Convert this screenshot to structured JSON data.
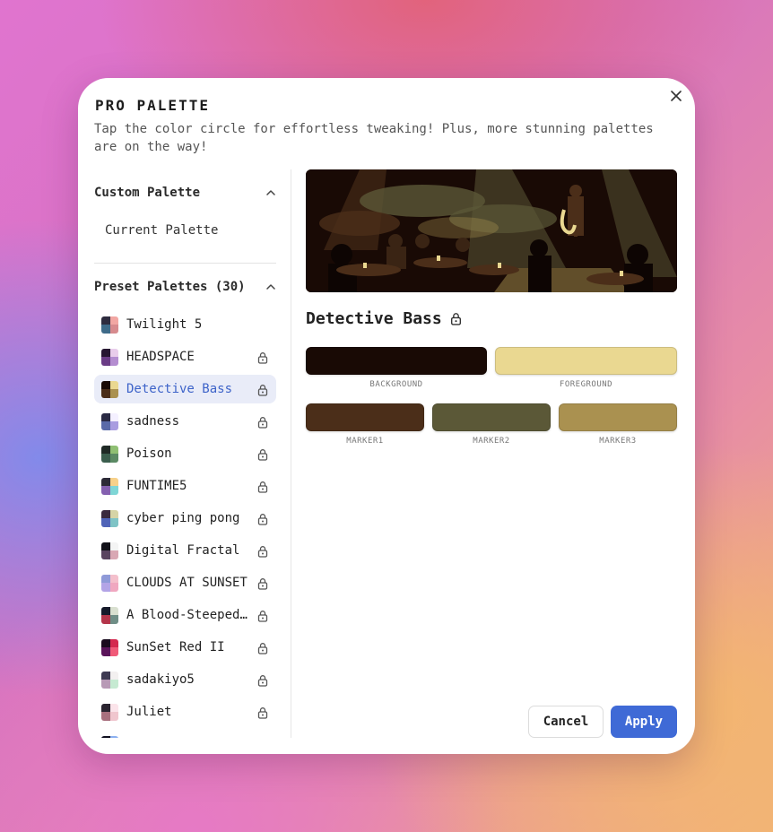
{
  "dialog": {
    "title": "PRO PALETTE",
    "subtitle": "Tap the color circle for effortless tweaking! Plus, more stunning palettes are on the way!"
  },
  "custom": {
    "heading": "Custom Palette",
    "current_label": "Current Palette"
  },
  "presets": {
    "heading": "Preset Palettes (30)",
    "items": [
      {
        "name": "Twilight 5",
        "locked": false,
        "colors": [
          "#2e2c3f",
          "#f2a7a3",
          "#3f6b89",
          "#d78b8e"
        ]
      },
      {
        "name": "HEADSPACE",
        "locked": true,
        "colors": [
          "#261631",
          "#e9cdeb",
          "#6a3c86",
          "#b48dd0"
        ]
      },
      {
        "name": "Detective Bass",
        "locked": true,
        "selected": true,
        "colors": [
          "#190a05",
          "#ead891",
          "#4b2e19",
          "#aa9150"
        ]
      },
      {
        "name": "sadness",
        "locked": true,
        "colors": [
          "#2a2a44",
          "#f4f0ff",
          "#5a6aa8",
          "#a99de0"
        ]
      },
      {
        "name": "Poison",
        "locked": true,
        "colors": [
          "#1f2a25",
          "#8fbf73",
          "#3b5e4d",
          "#5b8a64"
        ]
      },
      {
        "name": "FUNTIME5",
        "locked": true,
        "colors": [
          "#2c2a37",
          "#f7d18a",
          "#8460b0",
          "#7fd6d6"
        ]
      },
      {
        "name": "cyber ping pong",
        "locked": true,
        "colors": [
          "#3a2a3e",
          "#d6d4a6",
          "#5064b8",
          "#7fc4c6"
        ]
      },
      {
        "name": "Digital Fractal",
        "locked": true,
        "colors": [
          "#111118",
          "#f4f4f4",
          "#5a4460",
          "#d9a8b4"
        ]
      },
      {
        "name": "CLOUDS AT SUNSET",
        "locked": true,
        "colors": [
          "#8f9ad8",
          "#f4c0cc",
          "#b3a4e6",
          "#f0a8c0"
        ]
      },
      {
        "name": "A Blood-Steeped Wilderness",
        "locked": true,
        "colors": [
          "#161a2a",
          "#d9e0d0",
          "#b4354a",
          "#6f8e86"
        ]
      },
      {
        "name": "SunSet Red II",
        "locked": true,
        "colors": [
          "#1a0b1e",
          "#d4284e",
          "#5a145a",
          "#f05a78"
        ]
      },
      {
        "name": "sadakiyo5",
        "locked": true,
        "colors": [
          "#3e3a52",
          "#f3f0f0",
          "#b89ab6",
          "#c6ead2"
        ]
      },
      {
        "name": "Juliet",
        "locked": true,
        "colors": [
          "#2a2430",
          "#fbe4ea",
          "#a8707e",
          "#f0c6ce"
        ]
      },
      {
        "name": "",
        "locked": true,
        "colors": [
          "#101020",
          "#8cb0f0",
          "#101020",
          "#8cb0f0"
        ]
      }
    ]
  },
  "detail": {
    "name": "Detective Bass",
    "colors": {
      "background": {
        "label": "BACKGROUND",
        "hex": "#190a05"
      },
      "foreground": {
        "label": "FOREGROUND",
        "hex": "#ead891"
      },
      "marker1": {
        "label": "MARKER1",
        "hex": "#4b2e19"
      },
      "marker2": {
        "label": "MARKER2",
        "hex": "#5b5837"
      },
      "marker3": {
        "label": "MARKER3",
        "hex": "#aa9150"
      }
    }
  },
  "buttons": {
    "cancel": "Cancel",
    "apply": "Apply"
  }
}
